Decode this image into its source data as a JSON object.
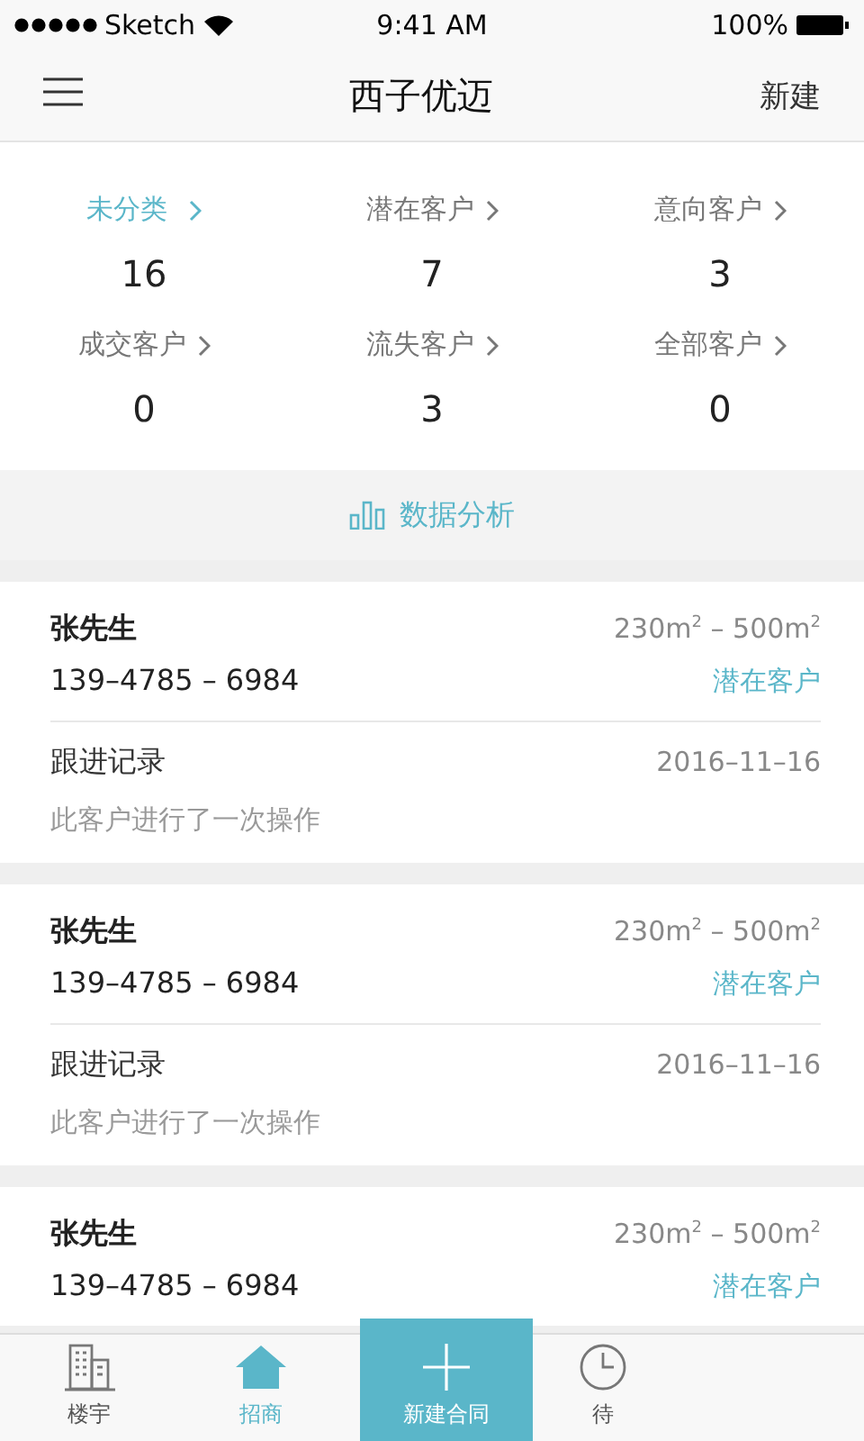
{
  "status_bar": {
    "carrier": "Sketch",
    "time": "9:41 AM",
    "battery": "100%"
  },
  "nav": {
    "title": "西子优迈",
    "action": "新建"
  },
  "categories": [
    {
      "label": "未分类",
      "count": "16",
      "selected": true
    },
    {
      "label": "潜在客户",
      "count": "7",
      "selected": false
    },
    {
      "label": "意向客户",
      "count": "3",
      "selected": false
    },
    {
      "label": "成交客户",
      "count": "0",
      "selected": false
    },
    {
      "label": "流失客户",
      "count": "3",
      "selected": false
    },
    {
      "label": "全部客户",
      "count": "0",
      "selected": false
    }
  ],
  "analysis": {
    "label": "数据分析"
  },
  "customers": [
    {
      "name": "张先生",
      "area": "230m$^{2}$ – 500m$^{2}$",
      "phone": "139–4785 – 6984",
      "status": "潜在客户",
      "record_label": "跟进记录",
      "record_date": "2016–11–16",
      "record_text": "此客户进行了一次操作"
    },
    {
      "name": "张先生",
      "area": "230m$^{2}$ – 500m$^{2}$",
      "phone": "139–4785 – 6984",
      "status": "潜在客户",
      "record_label": "跟进记录",
      "record_date": "2016–11–16",
      "record_text": "此客户进行了一次操作"
    },
    {
      "name": "张先生",
      "area": "230m$^{2}$ – 500m$^{2}$",
      "phone": "139–4785 – 6984",
      "status": "潜在客户"
    }
  ],
  "tabs": [
    {
      "label": "楼宇",
      "kind": "normal",
      "selected": false
    },
    {
      "label": "招商",
      "kind": "normal",
      "selected": true
    },
    {
      "label": "新建合同",
      "kind": "center",
      "selected": false
    },
    {
      "label": "待",
      "kind": "normal",
      "selected": false
    }
  ]
}
